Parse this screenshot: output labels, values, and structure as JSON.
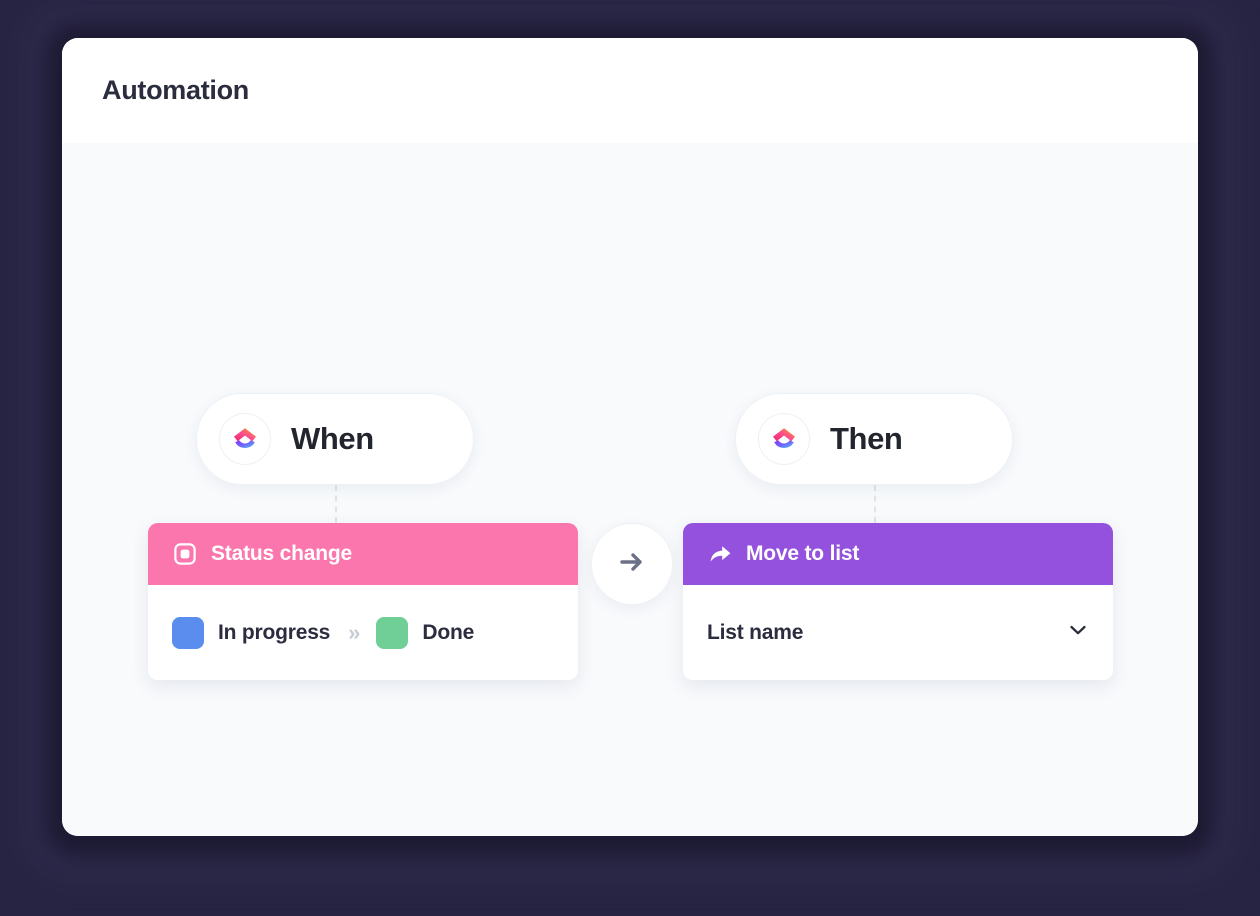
{
  "window": {
    "title": "Automation"
  },
  "canvas": {
    "flow_arrow_icon": "arrow-right-icon",
    "branches": [
      {
        "id": "when",
        "pill_label": "When",
        "pill_icon": "clickup-logo-icon",
        "card": {
          "header_icon": "status-square-icon",
          "header_title": "Status change",
          "header_color": "#FB76AC",
          "type": "status-transition",
          "from_status": {
            "label": "In progress",
            "color": "#5A8DEE"
          },
          "separator": "»",
          "to_status": {
            "label": "Done",
            "color": "#6FCF97"
          }
        }
      },
      {
        "id": "then",
        "pill_label": "Then",
        "pill_icon": "clickup-logo-icon",
        "card": {
          "header_icon": "share-arrow-icon",
          "header_title": "Move to list",
          "header_color": "#9351DE",
          "type": "select",
          "select_value": "List name",
          "select_icon": "chevron-down-icon"
        }
      }
    ]
  },
  "theme": {
    "page_background": "#272342",
    "panel_background": "#FFFFFF",
    "canvas_background": "#F8FAFC",
    "title_color": "#2B2D3F",
    "text_color": "#2B2D3F",
    "muted_color": "#C6CBD6"
  }
}
